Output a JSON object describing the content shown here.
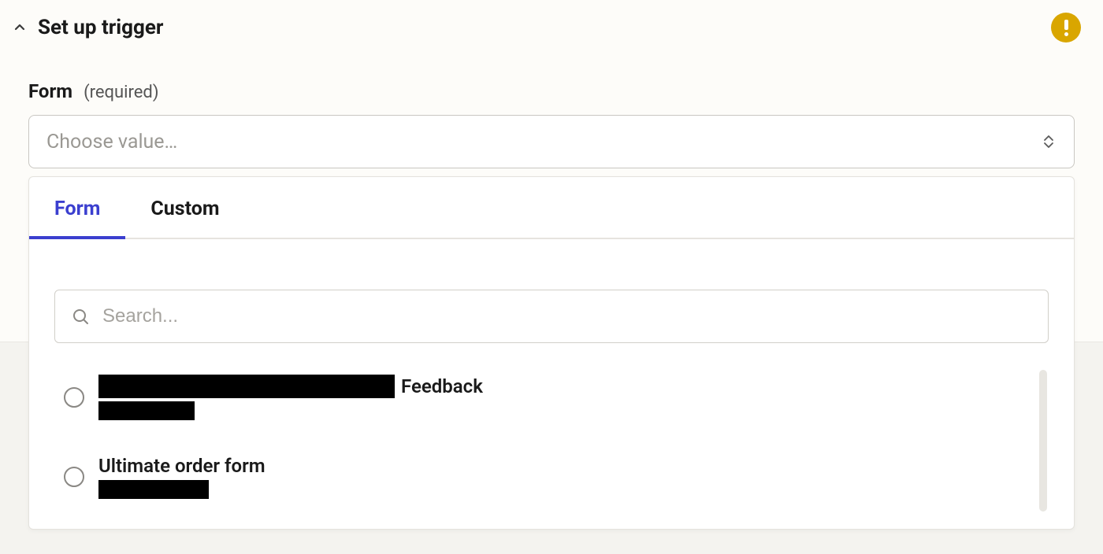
{
  "header": {
    "title": "Set up trigger",
    "status": "warning"
  },
  "field": {
    "label": "Form",
    "required_text": "(required)",
    "placeholder": "Choose value…"
  },
  "dropdown": {
    "tabs": [
      {
        "label": "Form",
        "active": true
      },
      {
        "label": "Custom",
        "active": false
      }
    ],
    "search_placeholder": "Search...",
    "options": [
      {
        "title_suffix": "Feedback",
        "title_redacted": true,
        "subtitle_redacted": true
      },
      {
        "title": "Ultimate order form",
        "title_redacted": false,
        "subtitle_redacted": true
      }
    ]
  }
}
